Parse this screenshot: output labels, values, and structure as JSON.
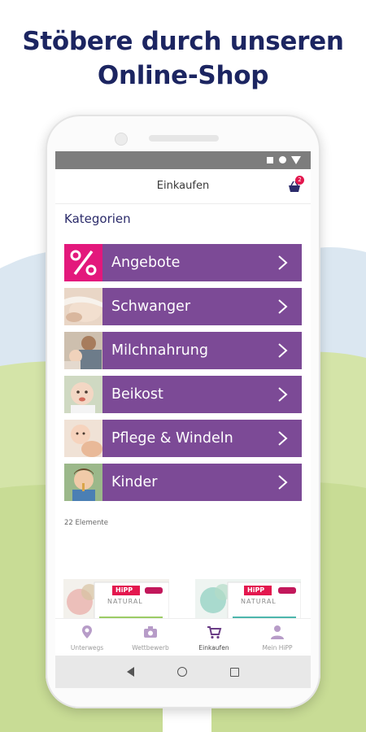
{
  "headline": {
    "line1": "Stöbere durch unseren",
    "line2": "Online-Shop"
  },
  "app": {
    "title": "Einkaufen",
    "cart_badge": "2"
  },
  "section_title": "Kategorien",
  "categories": [
    {
      "label": "Angebote",
      "thumb": "percent-icon"
    },
    {
      "label": "Schwanger",
      "thumb": "pregnant-belly-photo"
    },
    {
      "label": "Milchnahrung",
      "thumb": "mother-feeding-photo"
    },
    {
      "label": "Beikost",
      "thumb": "baby-eating-photo"
    },
    {
      "label": "Pflege & Windeln",
      "thumb": "baby-care-photo"
    },
    {
      "label": "Kinder",
      "thumb": "child-eating-photo"
    }
  ],
  "element_count": "22 Elemente",
  "products": [
    {
      "brand": "HiPP",
      "line": "NATURAL"
    },
    {
      "brand": "HiPP",
      "line": "NATURAL"
    }
  ],
  "bottom_nav": [
    {
      "label": "Unterwegs",
      "icon": "map-pin-icon",
      "active": false
    },
    {
      "label": "Wettbewerb",
      "icon": "camera-icon",
      "active": false
    },
    {
      "label": "Einkaufen",
      "icon": "cart-icon",
      "active": true
    },
    {
      "label": "Mein HiPP",
      "icon": "person-icon",
      "active": false
    }
  ],
  "colors": {
    "brand_purple": "#7c4a96",
    "headline_navy": "#1c2561",
    "offer_pink": "#e3174e"
  }
}
